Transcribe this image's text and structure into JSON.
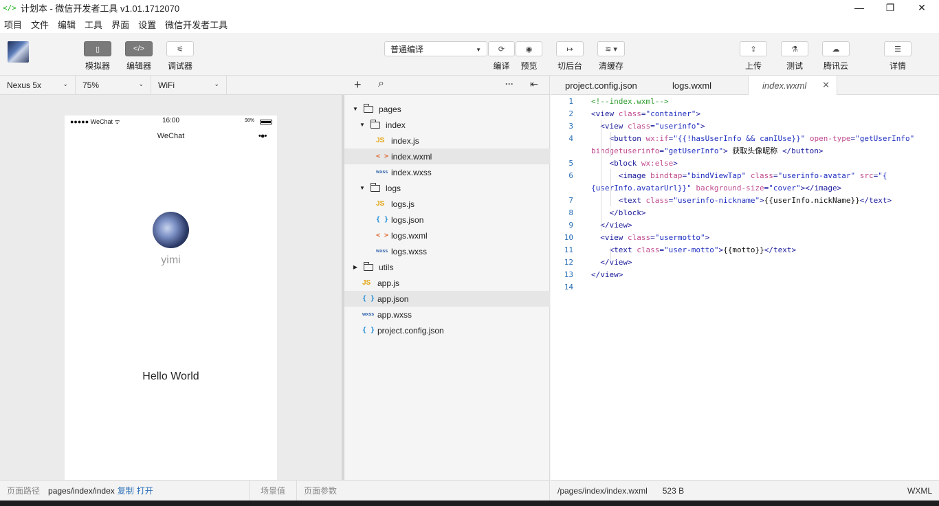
{
  "window": {
    "logo": "</>",
    "title": "计划本 - 微信开发者工具 v1.01.1712070",
    "minimize": "—",
    "maximize": "❐",
    "close": "✕"
  },
  "menu": [
    "项目",
    "文件",
    "编辑",
    "工具",
    "界面",
    "设置",
    "微信开发者工具"
  ],
  "toolbar": {
    "simulator": "模拟器",
    "editor": "编辑器",
    "debugger": "调试器",
    "compile_mode": "普通编译",
    "compile": "编译",
    "preview": "预览",
    "background": "切后台",
    "clear_cache": "清缓存",
    "upload": "上传",
    "test": "测试",
    "tencent_cloud": "腾讯云",
    "details": "详情"
  },
  "device_bar": {
    "device": "Nexus 5x",
    "zoom": "75%",
    "network": "WiFi"
  },
  "simulator": {
    "status_signal": "●●●●● WeChat ᯤ",
    "status_time": "16:00",
    "status_battery": "98%",
    "nav_title": "WeChat",
    "nav_dots": "•●•",
    "nickname": "yimi",
    "motto": "Hello World"
  },
  "sim_footer": {
    "path_label": "页面路径",
    "path": "pages/index/index",
    "copy": "复制",
    "open": "打开",
    "scene": "场景值",
    "params": "页面参数"
  },
  "file_tree": [
    {
      "label": "pages",
      "type": "folder",
      "open": true,
      "depth": 0
    },
    {
      "label": "index",
      "type": "folder",
      "open": true,
      "depth": 1
    },
    {
      "label": "index.js",
      "type": "js",
      "depth": 2
    },
    {
      "label": "index.wxml",
      "type": "wxml",
      "depth": 2,
      "selected": true
    },
    {
      "label": "index.wxss",
      "type": "wxss",
      "depth": 2
    },
    {
      "label": "logs",
      "type": "folder",
      "open": true,
      "depth": 1
    },
    {
      "label": "logs.js",
      "type": "js",
      "depth": 2
    },
    {
      "label": "logs.json",
      "type": "json",
      "depth": 2
    },
    {
      "label": "logs.wxml",
      "type": "wxml",
      "depth": 2
    },
    {
      "label": "logs.wxss",
      "type": "wxss",
      "depth": 2
    },
    {
      "label": "utils",
      "type": "folder",
      "open": false,
      "depth": 0
    },
    {
      "label": "app.js",
      "type": "js",
      "depth": 0
    },
    {
      "label": "app.json",
      "type": "json",
      "depth": 0,
      "selected": true
    },
    {
      "label": "app.wxss",
      "type": "wxss",
      "depth": 0
    },
    {
      "label": "project.config.json",
      "type": "json",
      "depth": 0
    }
  ],
  "icons": {
    "js": "JS",
    "wxml": "< >",
    "json": "{ }",
    "wxss": "wxss",
    "add": "+",
    "search": "⌕",
    "more": "···",
    "collapse": "⇤"
  },
  "tabs": [
    {
      "label": "project.config.json",
      "active": false
    },
    {
      "label": "logs.wxml",
      "active": false
    },
    {
      "label": "index.wxml",
      "active": true
    }
  ],
  "code": [
    {
      "n": "1",
      "parts": [
        [
          "cm",
          "<!--index.wxml-->"
        ]
      ]
    },
    {
      "n": "2",
      "parts": [
        [
          "tg",
          "<view "
        ],
        [
          "at",
          "class"
        ],
        [
          "tg",
          "="
        ],
        [
          "st",
          "\"container\""
        ],
        [
          "tg",
          ">"
        ]
      ]
    },
    {
      "n": "3",
      "parts": [
        [
          "tx",
          "  "
        ],
        [
          "tg",
          "<view "
        ],
        [
          "at",
          "class"
        ],
        [
          "tg",
          "="
        ],
        [
          "st",
          "\"userinfo\""
        ],
        [
          "tg",
          ">"
        ]
      ]
    },
    {
      "n": "4",
      "parts": [
        [
          "tx",
          "    "
        ],
        [
          "tg",
          "<button "
        ],
        [
          "at",
          "wx:if"
        ],
        [
          "tg",
          "="
        ],
        [
          "st",
          "\"{{!hasUserInfo && canIUse}}\""
        ],
        [
          "tx",
          " "
        ],
        [
          "at",
          "open-type"
        ],
        [
          "tg",
          "="
        ],
        [
          "st",
          "\"getUserInfo\""
        ]
      ]
    },
    {
      "n": "",
      "parts": [
        [
          "at",
          "bindgetuserinfo"
        ],
        [
          "tg",
          "="
        ],
        [
          "st",
          "\"getUserInfo\""
        ],
        [
          "tg",
          ">"
        ],
        [
          "tx",
          " 获取头像昵称 "
        ],
        [
          "tg",
          "</button>"
        ]
      ]
    },
    {
      "n": "5",
      "parts": [
        [
          "tx",
          "    "
        ],
        [
          "tg",
          "<block "
        ],
        [
          "at",
          "wx:else"
        ],
        [
          "tg",
          ">"
        ]
      ]
    },
    {
      "n": "6",
      "parts": [
        [
          "tx",
          "      "
        ],
        [
          "tg",
          "<image "
        ],
        [
          "at",
          "bindtap"
        ],
        [
          "tg",
          "="
        ],
        [
          "st",
          "\"bindViewTap\""
        ],
        [
          "tx",
          " "
        ],
        [
          "at",
          "class"
        ],
        [
          "tg",
          "="
        ],
        [
          "st",
          "\"userinfo-avatar\""
        ],
        [
          "tx",
          " "
        ],
        [
          "at",
          "src"
        ],
        [
          "tg",
          "="
        ],
        [
          "st",
          "\"{"
        ]
      ]
    },
    {
      "n": "",
      "parts": [
        [
          "st",
          "{userInfo.avatarUrl}}\""
        ],
        [
          "tx",
          " "
        ],
        [
          "at",
          "background-size"
        ],
        [
          "tg",
          "="
        ],
        [
          "st",
          "\"cover\""
        ],
        [
          "tg",
          "></image>"
        ]
      ]
    },
    {
      "n": "7",
      "parts": [
        [
          "tx",
          "      "
        ],
        [
          "tg",
          "<text "
        ],
        [
          "at",
          "class"
        ],
        [
          "tg",
          "="
        ],
        [
          "st",
          "\"userinfo-nickname\""
        ],
        [
          "tg",
          ">"
        ],
        [
          "tx",
          "{{userInfo.nickName}}"
        ],
        [
          "tg",
          "</text>"
        ]
      ]
    },
    {
      "n": "8",
      "parts": [
        [
          "tx",
          "    "
        ],
        [
          "tg",
          "</block>"
        ]
      ]
    },
    {
      "n": "9",
      "parts": [
        [
          "tx",
          "  "
        ],
        [
          "tg",
          "</view>"
        ]
      ]
    },
    {
      "n": "10",
      "parts": [
        [
          "tx",
          "  "
        ],
        [
          "tg",
          "<view "
        ],
        [
          "at",
          "class"
        ],
        [
          "tg",
          "="
        ],
        [
          "st",
          "\"usermotto\""
        ],
        [
          "tg",
          ">"
        ]
      ]
    },
    {
      "n": "11",
      "parts": [
        [
          "tx",
          "    "
        ],
        [
          "tg",
          "<text "
        ],
        [
          "at",
          "class"
        ],
        [
          "tg",
          "="
        ],
        [
          "st",
          "\"user-motto\""
        ],
        [
          "tg",
          ">"
        ],
        [
          "tx",
          "{{motto}}"
        ],
        [
          "tg",
          "</text>"
        ]
      ]
    },
    {
      "n": "12",
      "parts": [
        [
          "tx",
          "  "
        ],
        [
          "tg",
          "</view>"
        ]
      ]
    },
    {
      "n": "13",
      "parts": [
        [
          "tg",
          "</view>"
        ]
      ]
    },
    {
      "n": "14",
      "parts": []
    }
  ],
  "editor_footer": {
    "path": "/pages/index/index.wxml",
    "size": "523 B",
    "lang": "WXML"
  },
  "colors": {
    "js": "#e2a20a",
    "wxml": "#e0622a",
    "json": "#1a8ad6",
    "wxss": "#2b5fa8",
    "link": "#2a6fb8"
  }
}
